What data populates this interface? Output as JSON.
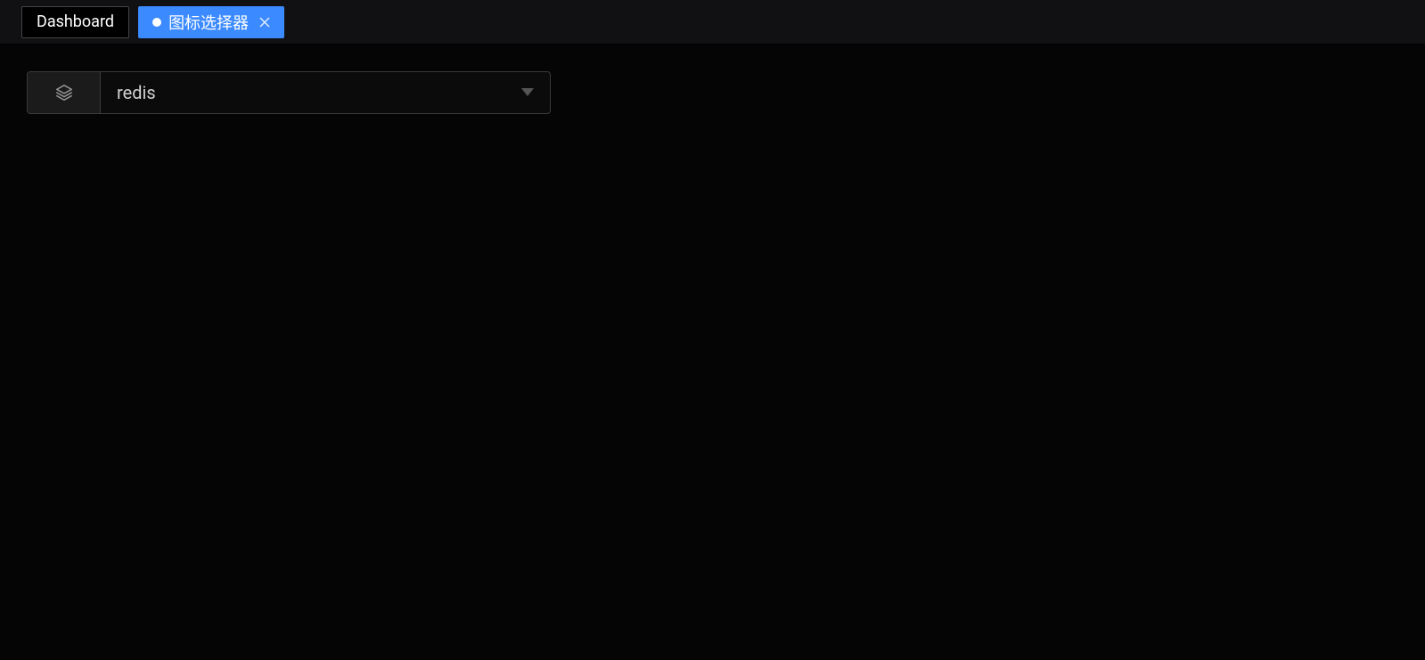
{
  "tabs": [
    {
      "label": "Dashboard",
      "active": false,
      "unsaved": false,
      "closable": false
    },
    {
      "label": "图标选择器",
      "active": true,
      "unsaved": true,
      "closable": true
    }
  ],
  "icon_picker": {
    "selected_value": "redis",
    "prefix_icon": "layers-icon"
  }
}
